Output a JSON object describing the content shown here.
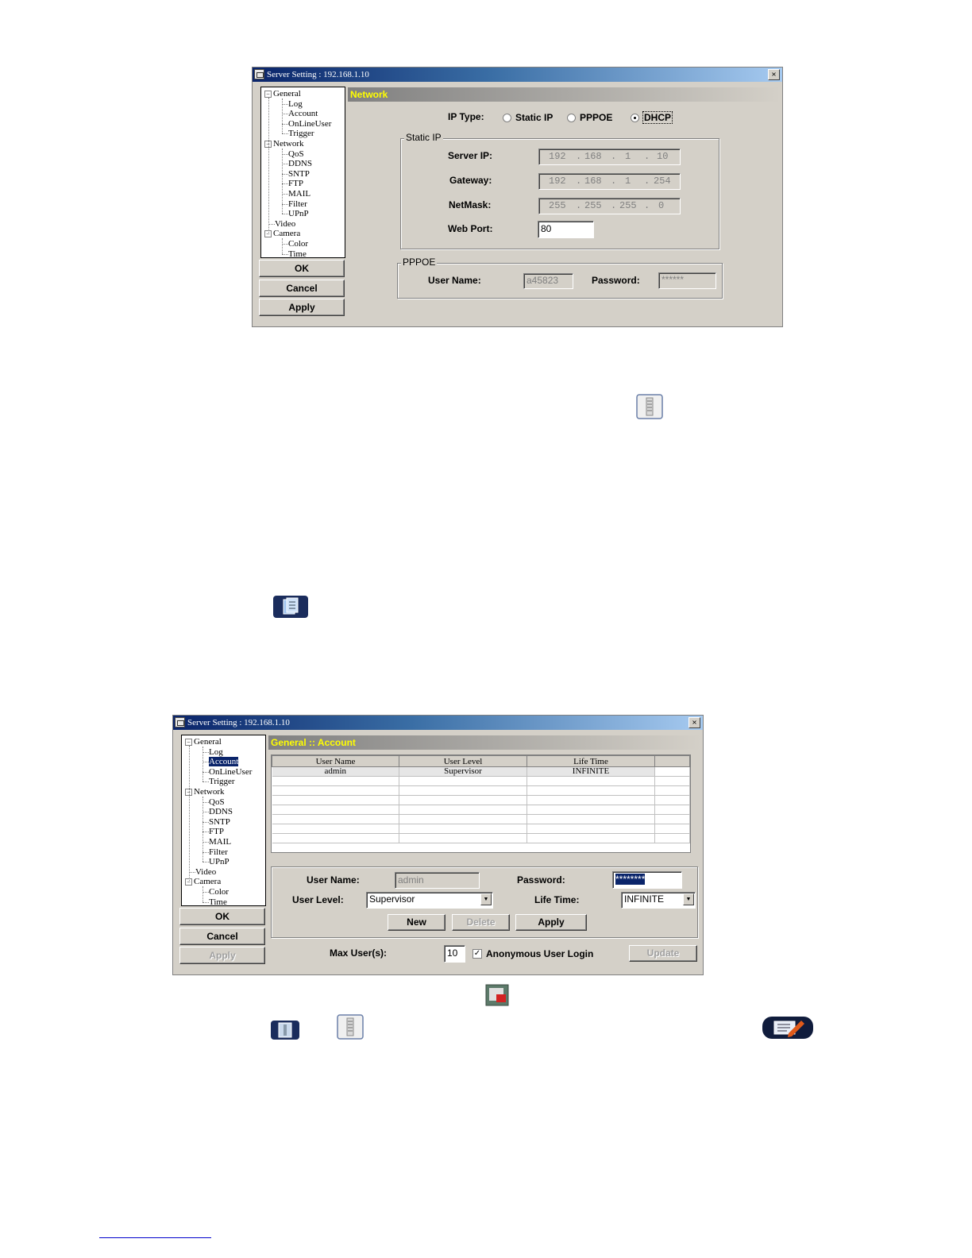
{
  "network_window": {
    "title": "Server Setting : 192.168.1.10",
    "close_glyph": "×",
    "section_title": "Network",
    "tree": [
      {
        "label": "General",
        "expander": "−"
      },
      {
        "label": "Log"
      },
      {
        "label": "Account"
      },
      {
        "label": "OnLineUser"
      },
      {
        "label": "Trigger"
      },
      {
        "label": "Network",
        "expander": "−"
      },
      {
        "label": "QoS"
      },
      {
        "label": "DDNS"
      },
      {
        "label": "SNTP"
      },
      {
        "label": "FTP"
      },
      {
        "label": "MAIL"
      },
      {
        "label": "Filter"
      },
      {
        "label": "UPnP"
      },
      {
        "label": "Video"
      },
      {
        "label": "Camera",
        "expander": "−"
      },
      {
        "label": "Color"
      },
      {
        "label": "Time"
      }
    ],
    "buttons": {
      "ok": "OK",
      "cancel": "Cancel",
      "apply": "Apply"
    },
    "ip_type_label": "IP Type:",
    "ip_type_options": [
      "Static IP",
      "PPPOE",
      "DHCP"
    ],
    "ip_type_selected": "DHCP",
    "static_ip_group": "Static IP",
    "server_ip_label": "Server IP:",
    "server_ip": [
      "192",
      "168",
      "1",
      "10"
    ],
    "gateway_label": "Gateway:",
    "gateway": [
      "192",
      "168",
      "1",
      "254"
    ],
    "netmask_label": "NetMask:",
    "netmask": [
      "255",
      "255",
      "255",
      "0"
    ],
    "web_port_label": "Web Port:",
    "web_port": "80",
    "pppoe_group": "PPPOE",
    "pppoe_user_label": "User Name:",
    "pppoe_user": "a45823",
    "pppoe_password_label": "Password:",
    "pppoe_password": "******",
    "ip_dot": "."
  },
  "account_window": {
    "title": "Server Setting : 192.168.1.10",
    "close_glyph": "×",
    "section_title": "General :: Account",
    "tree_selected": "Account",
    "buttons": {
      "ok": "OK",
      "cancel": "Cancel",
      "apply": "Apply"
    },
    "table_columns": [
      "User Name",
      "User Level",
      "Life Time"
    ],
    "table_rows": [
      [
        "admin",
        "Supervisor",
        "INFINITE"
      ]
    ],
    "user_name_label": "User Name:",
    "user_name": "admin",
    "password_label": "Password:",
    "password": "********",
    "user_level_label": "User Level:",
    "user_level": "Supervisor",
    "life_time_label": "Life Time:",
    "life_time": "INFINITE",
    "new_button": "New",
    "delete_button": "Delete",
    "apply_button": "Apply",
    "max_users_label": "Max User(s):",
    "max_users": "10",
    "anonymous_label": "Anonymous User Login",
    "anonymous_checked": true,
    "check_glyph": "✓",
    "update_button": "Update",
    "combo_arrow": "▼"
  },
  "icons": [
    "info-icon",
    "list-icon",
    "exit-icon",
    "info-dark-icon",
    "info-light-icon",
    "edit-icon"
  ],
  "colors": {
    "section_title": "#ffff00",
    "titlebar": "#0a246a",
    "dialog": "#d4d0c8"
  }
}
